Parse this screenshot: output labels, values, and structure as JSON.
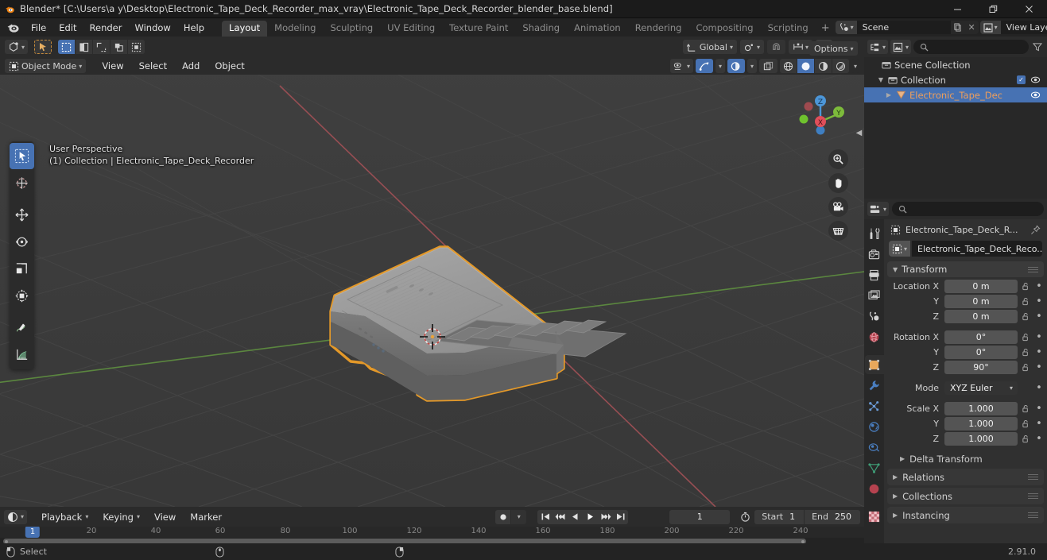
{
  "window": {
    "title": "Blender* [C:\\Users\\a y\\Desktop\\Electronic_Tape_Deck_Recorder_max_vray\\Electronic_Tape_Deck_Recorder_blender_base.blend]",
    "minimize": "—",
    "maximize": "❐",
    "close": "✕"
  },
  "topbar": {
    "menus": [
      "File",
      "Edit",
      "Render",
      "Window",
      "Help"
    ],
    "workspaces": [
      {
        "label": "Layout",
        "active": true
      },
      {
        "label": "Modeling",
        "active": false
      },
      {
        "label": "Sculpting",
        "active": false
      },
      {
        "label": "UV Editing",
        "active": false
      },
      {
        "label": "Texture Paint",
        "active": false
      },
      {
        "label": "Shading",
        "active": false
      },
      {
        "label": "Animation",
        "active": false
      },
      {
        "label": "Rendering",
        "active": false
      },
      {
        "label": "Compositing",
        "active": false
      },
      {
        "label": "Scripting",
        "active": false
      }
    ],
    "add_workspace": "+",
    "scene_name": "Scene",
    "view_layer_name": "View Layer"
  },
  "viewport": {
    "header": {
      "mode": "Object Mode",
      "menus": [
        "View",
        "Select",
        "Add",
        "Object"
      ],
      "transform_orientation": "Global",
      "options_label": "Options"
    },
    "overlay_text": {
      "line1": "User Perspective",
      "line2": "(1) Collection | Electronic_Tape_Deck_Recorder"
    },
    "gizmo_axes": {
      "x": "X",
      "y": "Y",
      "z": "Z"
    },
    "tools": [
      "tweak-select-tool",
      "cursor-tool",
      "move-tool",
      "rotate-tool",
      "scale-tool",
      "transform-tool",
      "annotate-tool",
      "measure-tool"
    ],
    "nav_buttons": [
      "zoom-navigate",
      "pan-navigate",
      "camera-view",
      "toggle-orthographic"
    ],
    "colors": {
      "background": "#3b3b3b",
      "selection_outline": "#ed9e28",
      "axis_x": "#9c4f54",
      "axis_y": "#6f9c42",
      "object_grey": "#9a9a9a"
    }
  },
  "outliner": {
    "search_placeholder": "",
    "rows": [
      {
        "name": "Scene Collection",
        "indent": 0,
        "icon": "collection-icon",
        "selected": false,
        "has_disclosure": false,
        "has_checkbox": false,
        "has_eye": false
      },
      {
        "name": "Collection",
        "indent": 1,
        "icon": "collection-icon",
        "selected": false,
        "has_disclosure": true,
        "disclosure": "▼",
        "has_checkbox": true,
        "has_eye": true
      },
      {
        "name": "Electronic_Tape_Dec",
        "indent": 2,
        "icon": "mesh-object-icon",
        "selected": true,
        "has_disclosure": true,
        "disclosure": "▶",
        "has_checkbox": false,
        "has_eye": true
      }
    ]
  },
  "properties": {
    "search_placeholder": "",
    "breadcrumb_object": "Electronic_Tape_Deck_R...",
    "object_id_field": "Electronic_Tape_Deck_Reco...",
    "tabs": [
      {
        "name": "tool-tab",
        "active": false
      },
      {
        "name": "render-tab",
        "active": false
      },
      {
        "name": "output-tab",
        "active": false
      },
      {
        "name": "view-layer-tab",
        "active": false
      },
      {
        "name": "scene-tab",
        "active": false
      },
      {
        "name": "world-tab",
        "active": false
      },
      {
        "name": "object-tab",
        "active": true
      },
      {
        "name": "modifier-tab",
        "active": false
      },
      {
        "name": "particles-tab",
        "active": false
      },
      {
        "name": "physics-tab",
        "active": false
      },
      {
        "name": "constraints-tab",
        "active": false
      },
      {
        "name": "data-tab",
        "active": false
      },
      {
        "name": "material-tab",
        "active": false
      },
      {
        "name": "texture-tab",
        "active": false
      }
    ],
    "transform": {
      "title": "Transform",
      "location": {
        "label_x": "Location X",
        "label_y": "Y",
        "label_z": "Z",
        "x": "0 m",
        "y": "0 m",
        "z": "0 m"
      },
      "rotation": {
        "label_x": "Rotation X",
        "label_y": "Y",
        "label_z": "Z",
        "x": "0°",
        "y": "0°",
        "z": "90°"
      },
      "mode": {
        "label": "Mode",
        "value": "XYZ Euler"
      },
      "scale": {
        "label_x": "Scale X",
        "label_y": "Y",
        "label_z": "Z",
        "x": "1.000",
        "y": "1.000",
        "z": "1.000"
      },
      "delta_transform": "Delta Transform"
    },
    "closed_panels": [
      "Relations",
      "Collections",
      "Instancing"
    ]
  },
  "timeline": {
    "editor_menus": [
      "Playback",
      "Keying",
      "View",
      "Marker"
    ],
    "current_frame": "1",
    "start_label": "Start",
    "start_value": "1",
    "end_label": "End",
    "end_value": "250",
    "ruler_ticks": [
      "20",
      "40",
      "60",
      "80",
      "100",
      "120",
      "140",
      "160",
      "180",
      "200",
      "220",
      "240"
    ],
    "playhead_frame": "1",
    "transport": [
      "jump-to-start",
      "prev-keyframe",
      "play-reverse",
      "play",
      "next-keyframe",
      "jump-to-end"
    ]
  },
  "statusbar": {
    "mouse_left_action": "Select",
    "version": "2.91.0"
  }
}
